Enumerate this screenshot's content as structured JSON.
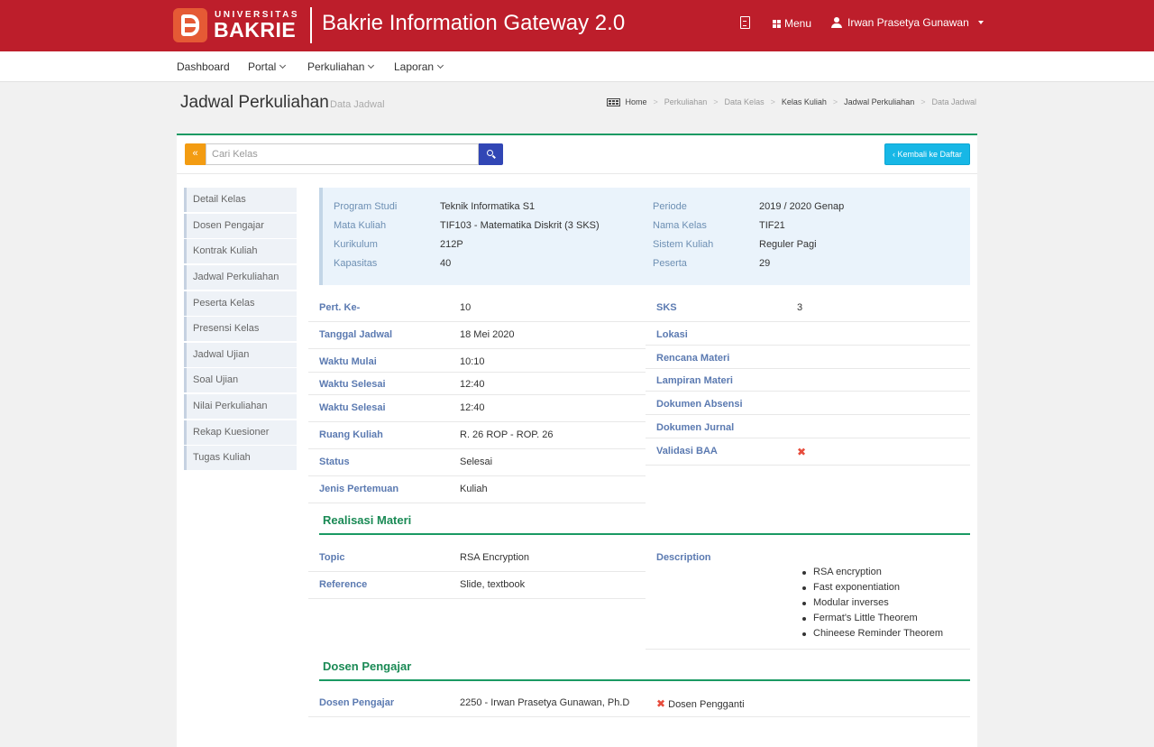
{
  "brand": {
    "logo_top": "UNIVERSITAS",
    "logo_bottom": "BAKRIE",
    "app_title": "Bakrie Information Gateway 2.0"
  },
  "header": {
    "doc_icon": "document-icon",
    "menu_label": "Menu",
    "user_name": "Irwan Prasetya Gunawan"
  },
  "nav": {
    "items": [
      {
        "label": "Dashboard"
      },
      {
        "label": "Portal"
      },
      {
        "label": "Perkuliahan"
      },
      {
        "label": "Laporan"
      }
    ]
  },
  "page": {
    "title": "Jadwal Perkuliahan",
    "subtitle": "Data Jadwal"
  },
  "breadcrumb": [
    "Home",
    "Perkuliahan",
    "Data Kelas",
    "Kelas Kuliah",
    "Jadwal Perkuliahan",
    "Data Jadwal"
  ],
  "toolbar": {
    "back_symbol": "«",
    "search_placeholder": "Cari Kelas",
    "search_value": "",
    "back_label": "Kembali ke Daftar"
  },
  "sidebar": {
    "items": [
      {
        "label": "Detail Kelas"
      },
      {
        "label": "Dosen Pengajar"
      },
      {
        "label": "Kontrak Kuliah"
      },
      {
        "label": "Jadwal Perkuliahan"
      },
      {
        "label": "Peserta Kelas"
      },
      {
        "label": "Presensi Kelas"
      },
      {
        "label": "Jadwal Ujian"
      },
      {
        "label": "Soal Ujian"
      },
      {
        "label": "Nilai Perkuliahan"
      },
      {
        "label": "Rekap Kuesioner"
      },
      {
        "label": "Tugas Kuliah"
      }
    ]
  },
  "info": {
    "program_studi_label": "Program Studi",
    "program_studi": "Teknik Informatika S1",
    "mata_kuliah_label": "Mata Kuliah",
    "mata_kuliah": "TIF103 - Matematika Diskrit (3 SKS)",
    "kurikulum_label": "Kurikulum",
    "kurikulum": "212P",
    "kapasitas_label": "Kapasitas",
    "kapasitas": "40",
    "periode_label": "Periode",
    "periode": "2019 / 2020 Genap",
    "nama_kelas_label": "Nama Kelas",
    "nama_kelas": "TIF21",
    "sistem_kuliah_label": "Sistem Kuliah",
    "sistem_kuliah": "Reguler Pagi",
    "peserta_label": "Peserta",
    "peserta": "29"
  },
  "detail_left": [
    {
      "label": "Pert. Ke-",
      "value": "10"
    },
    {
      "label": "Tanggal Jadwal",
      "value": "18 Mei 2020"
    },
    {
      "label": "Waktu Mulai",
      "value": "10:10"
    },
    {
      "label": "Waktu Selesai",
      "value": "12:40"
    },
    {
      "label": "Waktu Selesai",
      "value": "12:40"
    },
    {
      "label": "Ruang Kuliah",
      "value": "R. 26 ROP - ROP. 26"
    },
    {
      "label": "Status",
      "value": "Selesai"
    },
    {
      "label": "Jenis Pertemuan",
      "value": "Kuliah"
    }
  ],
  "detail_right": [
    {
      "label": "SKS",
      "value": "3"
    },
    {
      "label": "Lokasi",
      "value": ""
    },
    {
      "label": "Rencana Materi",
      "value": ""
    },
    {
      "label": "Lampiran Materi",
      "value": ""
    },
    {
      "label": "Dokumen Absensi",
      "value": ""
    },
    {
      "label": "Dokumen Jurnal",
      "value": ""
    },
    {
      "label": "Validasi BAA",
      "value": "✖"
    }
  ],
  "realisasi": {
    "title": "Realisasi Materi",
    "topic_label": "Topic",
    "topic": "RSA Encryption",
    "reference_label": "Reference",
    "reference": "Slide, textbook",
    "description_label": "Description",
    "description_items": [
      "RSA encryption",
      "Fast exponentiation",
      "Modular inverses",
      "Fermat's Little Theorem",
      "Chineese Reminder Theorem"
    ]
  },
  "dosen": {
    "title": "Dosen Pengajar",
    "label": "Dosen Pengajar",
    "value": "2250 - Irwan Prasetya Gunawan, Ph.D",
    "pengganti_mark": "✖",
    "pengganti_label": "Dosen Pengganti"
  },
  "colors": {
    "header_red": "#bd1e2b",
    "accent_green": "#1a9a63",
    "label_blue": "#5b7ab1",
    "button_cyan": "#17b7e6",
    "button_orange": "#f39c12",
    "search_blue": "#3146b5"
  }
}
